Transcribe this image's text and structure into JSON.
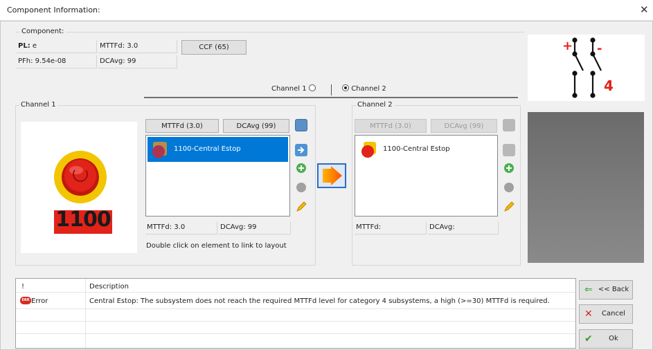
{
  "window": {
    "title": "Component Information:",
    "close_glyph": "✕"
  },
  "component": {
    "group_label": "Component:",
    "pl_label": "PL:",
    "pl_value": "e",
    "mttfd": "MTTFd: 3.0",
    "ccf_button": "CCF (65)",
    "pfh": "PFh: 9.54e-08",
    "dcavg": "DCAvg: 99"
  },
  "schematic": {
    "plus": "+",
    "minus": "-",
    "number": "4"
  },
  "channel_select": {
    "channel1": "Channel 1",
    "channel2": "Channel 2",
    "selected": "Channel 2"
  },
  "channel1": {
    "group_label": "Channel 1",
    "mttfd_button": "MTTFd (3.0)",
    "dcavg_button": "DCAvg (99)",
    "items": [
      {
        "label": "1100-Central Estop",
        "selected": true
      }
    ],
    "mttfd_value": "MTTFd: 3.0",
    "dcavg_value": "DCAvg: 99",
    "hint": "Double click on element to link to layout",
    "preview_label": "1100"
  },
  "channel2": {
    "group_label": "Channel 2",
    "mttfd_button": "MTTFd (3.0)",
    "dcavg_button": "DCAvg (99)",
    "items": [
      {
        "label": "1100-Central Estop",
        "selected": false
      }
    ],
    "mttfd_value": "MTTFd:",
    "dcavg_value": "DCAvg:"
  },
  "messages": {
    "columns": [
      "!",
      "Description"
    ],
    "rows": [
      {
        "type": "Error",
        "badge": "ERR",
        "description": "Central Estop: The subsystem does not reach the required MTTFd level for category 4 subsystems, a high (>=30) MTTFd is required."
      }
    ]
  },
  "actions": {
    "back": "<< Back",
    "cancel": "Cancel",
    "ok": "Ok"
  },
  "colors": {
    "selection": "#0078d7",
    "error": "#d62b1f",
    "ok_green": "#3a9a2a",
    "back_green": "#3aa53a",
    "estop_red": "#e2231a",
    "estop_yellow": "#f2c500"
  }
}
